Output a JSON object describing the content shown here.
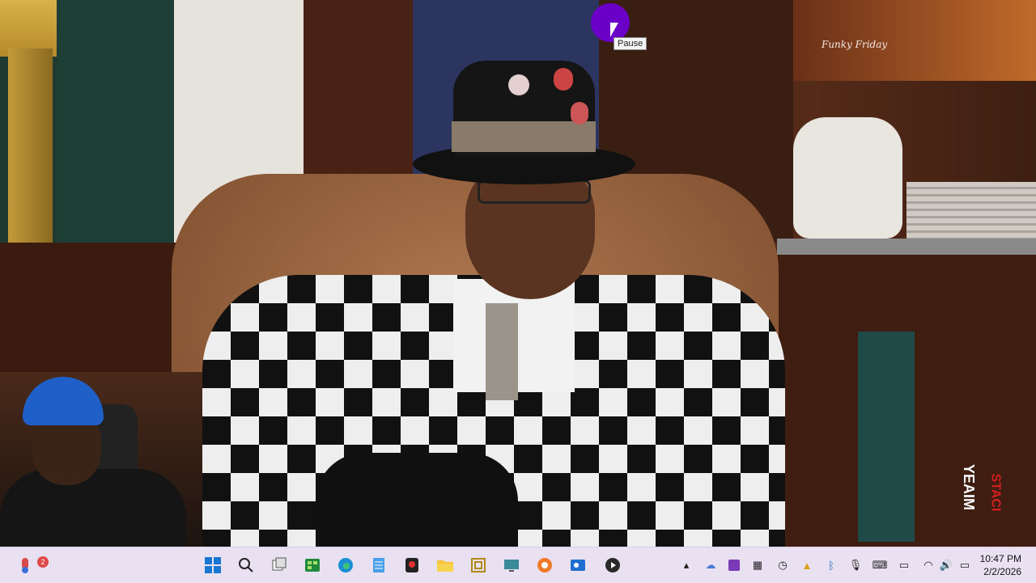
{
  "video": {
    "watermark_text": "Funky Friday",
    "side_overlay_text": "YEAIM",
    "side_overlay_text2": "STACI",
    "tooltip": "Pause"
  },
  "taskbar": {
    "widgets_badge": "2",
    "icons": [
      "widgets-icon",
      "start-icon",
      "search-icon",
      "task-view-icon",
      "excel-icon",
      "edge-icon",
      "notepad-icon",
      "recorder-icon",
      "file-explorer-icon",
      "archive-icon",
      "screen-tool-icon",
      "capcut-icon",
      "outlook-icon",
      "media-player-icon"
    ],
    "tray": [
      "chevron-up-icon",
      "cloud-icon",
      "onenote-icon",
      "grid-icon",
      "timer-icon",
      "warning-icon",
      "bluetooth-icon",
      "microphone-icon",
      "keyboard-icon",
      "display-icon",
      "wifi-icon",
      "volume-icon",
      "battery-icon"
    ],
    "time": "10:47 PM",
    "date": "2/2/2026"
  },
  "colors": {
    "taskbar_bg": "#e9e1f2",
    "cursor_circle": "#6a00c8"
  }
}
